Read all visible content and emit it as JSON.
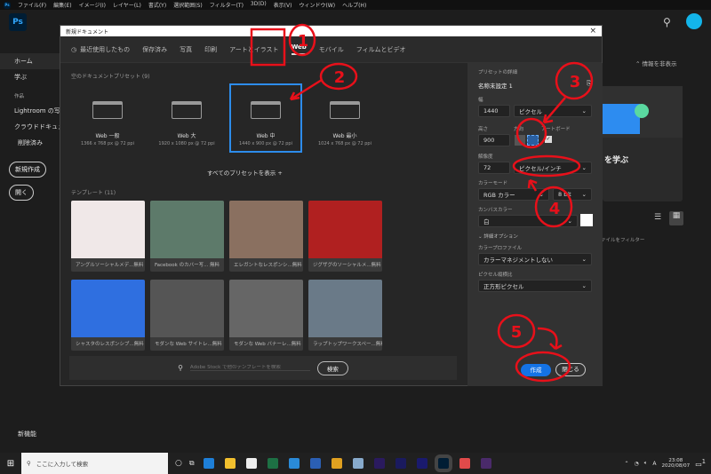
{
  "menubar": {
    "app_icon": "Ps",
    "items": [
      "ファイル(F)",
      "編集(E)",
      "イメージ(I)",
      "レイヤー(L)",
      "書式(Y)",
      "選択範囲(S)",
      "フィルター(T)",
      "3D(D)",
      "表示(V)",
      "ウィンドウ(W)",
      "ヘルプ(H)"
    ]
  },
  "app": {
    "logo": "Ps",
    "sidebar": {
      "items": [
        "ホーム",
        "学ぶ"
      ],
      "section": "作品",
      "sub_items": [
        "Lightroom の写真",
        "クラウドドキュメント",
        "削除済み"
      ],
      "new_button": "新規作成",
      "open_button": "開く",
      "whats_new": "新機能"
    },
    "right": {
      "hide_info": "情報を非表示",
      "learn": "を学ぶ",
      "filter": "ァイルをフィルター"
    }
  },
  "dialog": {
    "title": "新規ドキュメント",
    "close": "×",
    "tabs": [
      {
        "label": "最近使用したもの"
      },
      {
        "label": "保存済み"
      },
      {
        "label": "写真"
      },
      {
        "label": "印刷"
      },
      {
        "label": "アートとイラスト"
      },
      {
        "label": "Web",
        "active": true
      },
      {
        "label": "モバイル"
      },
      {
        "label": "フィルムとビデオ"
      }
    ],
    "presets_header": "空のドキュメントプリセット (9)",
    "presets": [
      {
        "name": "Web 一般",
        "desc": "1366 x 768 px @ 72 ppi"
      },
      {
        "name": "Web 大",
        "desc": "1920 x 1080 px @ 72 ppi"
      },
      {
        "name": "Web 中",
        "desc": "1440 x 900 px @ 72 ppi",
        "selected": true
      },
      {
        "name": "Web 最小",
        "desc": "1024 x 768 px @ 72 ppi"
      }
    ],
    "show_all": "すべてのプリセットを表示 +",
    "templates_header": "テンプレート (11)",
    "templates": [
      {
        "name": "アングルソーシャルメデ...",
        "price": "無料",
        "color": "#f0e8e8"
      },
      {
        "name": "Facebook のカバー写...",
        "price": "無料",
        "color": "#5d7a6a"
      },
      {
        "name": "エレガントなレスポンシ...",
        "price": "無料",
        "color": "#8a7060"
      },
      {
        "name": "ジグザグのソーシャルメ...",
        "price": "無料",
        "color": "#b02020"
      },
      {
        "name": "シャスタのレスポンシブ...",
        "price": "無料",
        "color": "#2f6fe0"
      },
      {
        "name": "モダンな Web サイトレ...",
        "price": "無料",
        "color": "#555"
      },
      {
        "name": "モダンな Web バナーレ...",
        "price": "無料",
        "color": "#666"
      },
      {
        "name": "ラップトップワークスペー...",
        "price": "無料",
        "color": "#6a7a88"
      }
    ],
    "search_placeholder": "Adobe Stock で他のテンプレートを検索",
    "search_button": "検索",
    "details": {
      "header": "プリセットの詳細",
      "name": "名称未設定 1",
      "width_label": "幅",
      "width": "1440",
      "width_unit": "ピクセル",
      "height_label": "高さ",
      "height": "900",
      "orientation_label": "方向",
      "artboard_label": "アートボード",
      "resolution_label": "解像度",
      "resolution": "72",
      "resolution_unit": "ピクセル/インチ",
      "color_mode_label": "カラーモード",
      "color_mode": "RGB カラー",
      "bit_depth": "8 bit",
      "canvas_label": "カンバスカラー",
      "canvas": "白",
      "advanced": "詳細オプション",
      "profile_label": "カラープロファイル",
      "profile": "カラーマネジメントしない",
      "aspect_label": "ピクセル縦横比",
      "aspect": "正方形ピクセル",
      "create": "作成",
      "close": "閉じる"
    }
  },
  "annotations": [
    "1",
    "2",
    "3",
    "4",
    "5"
  ],
  "annotation_color": "#e8101a",
  "taskbar": {
    "search_placeholder": "ここに入力して検索",
    "time": "23:08",
    "date": "2020/08/07",
    "notifications": "1",
    "apps": [
      {
        "name": "edge",
        "color": "#1e7fd8"
      },
      {
        "name": "explorer",
        "color": "#f2c02e"
      },
      {
        "name": "store",
        "color": "#eee"
      },
      {
        "name": "excel",
        "color": "#1d7044"
      },
      {
        "name": "mail",
        "color": "#2a8ad8"
      },
      {
        "name": "word",
        "color": "#2b5fb4"
      },
      {
        "name": "chrome",
        "color": "#e0a020"
      },
      {
        "name": "paint",
        "color": "#88aacc"
      },
      {
        "name": "premiere",
        "color": "#2a1a5e"
      },
      {
        "name": "after-effects",
        "color": "#1a1a5e"
      },
      {
        "name": "media-encoder",
        "color": "#1a1a6e"
      },
      {
        "name": "photoshop",
        "color": "#001d34"
      },
      {
        "name": "photos",
        "color": "#e04a4a"
      },
      {
        "name": "other",
        "color": "#4a2a6a"
      }
    ]
  }
}
